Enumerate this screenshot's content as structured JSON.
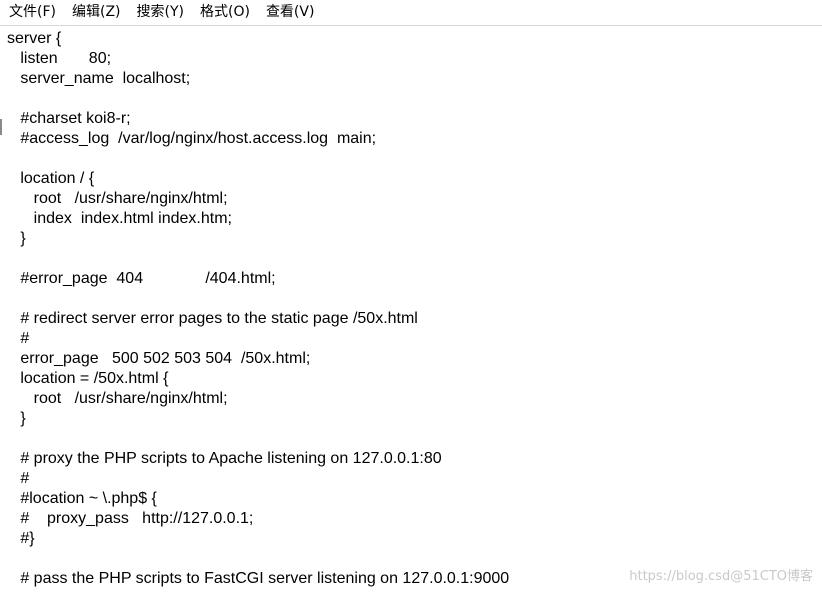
{
  "menubar": {
    "items": [
      {
        "label": "文件(F)"
      },
      {
        "label": "编辑(Z)"
      },
      {
        "label": "搜索(Y)"
      },
      {
        "label": "格式(O)"
      },
      {
        "label": "查看(V)"
      }
    ]
  },
  "editor": {
    "lines": [
      "server {",
      "   listen       80;",
      "   server_name  localhost;",
      "",
      "   #charset koi8-r;",
      "   #access_log  /var/log/nginx/host.access.log  main;",
      "",
      "   location / {",
      "      root   /usr/share/nginx/html;",
      "      index  index.html index.htm;",
      "   }",
      "",
      "   #error_page  404              /404.html;",
      "",
      "   # redirect server error pages to the static page /50x.html",
      "   #",
      "   error_page   500 502 503 504  /50x.html;",
      "   location = /50x.html {",
      "      root   /usr/share/nginx/html;",
      "   }",
      "",
      "   # proxy the PHP scripts to Apache listening on 127.0.0.1:80",
      "   #",
      "   #location ~ \\.php$ {",
      "   #    proxy_pass   http://127.0.0.1;",
      "   #}",
      "",
      "   # pass the PHP scripts to FastCGI server listening on 127.0.0.1:9000"
    ]
  },
  "watermark": {
    "text": "https://blog.csd@51CTO博客"
  }
}
